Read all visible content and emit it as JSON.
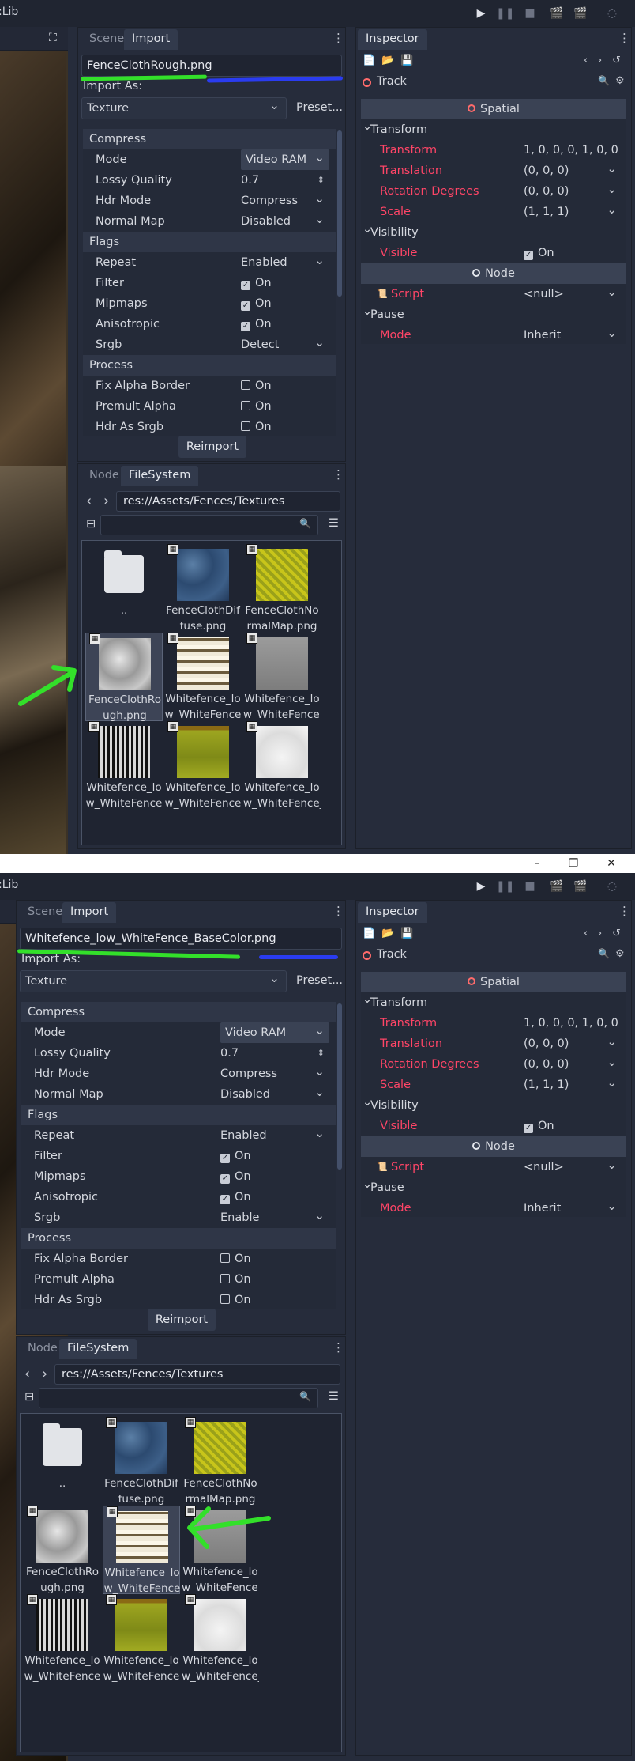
{
  "app": {
    "title": ":Lib"
  },
  "window": {
    "minimize": "–",
    "restore": "❐",
    "close": "✕"
  },
  "colors": {
    "accent": "#ff4567",
    "background": "#262c3b",
    "annotation_green": "#33e02a",
    "annotation_blue": "#2a3cf0"
  },
  "import_panel": {
    "tab_scene": "Scene",
    "tab_import": "Import",
    "import_as_label": "Import As:",
    "import_as_value": "Texture",
    "preset_label": "Preset...",
    "reimport_label": "Reimport"
  },
  "shots": [
    {
      "filename": "FenceClothRough.png",
      "props": [
        {
          "k": "Compress",
          "sec": true
        },
        {
          "k": "Mode",
          "v": "Video RAM",
          "dd": true,
          "btn": true
        },
        {
          "k": "Lossy Quality",
          "v": "0.7",
          "spin": true
        },
        {
          "k": "Hdr Mode",
          "v": "Compress",
          "dd": true
        },
        {
          "k": "Normal Map",
          "v": "Disabled",
          "dd": true
        },
        {
          "k": "Flags",
          "sec": true
        },
        {
          "k": "Repeat",
          "v": "Enabled",
          "dd": true
        },
        {
          "k": "Filter",
          "v": "On",
          "cb": true
        },
        {
          "k": "Mipmaps",
          "v": "On",
          "cb": true
        },
        {
          "k": "Anisotropic",
          "v": "On",
          "cb": true
        },
        {
          "k": "Srgb",
          "v": "Detect",
          "dd": true
        },
        {
          "k": "Process",
          "sec": true
        },
        {
          "k": "Fix Alpha Border",
          "v": "On",
          "cb": false
        },
        {
          "k": "Premult Alpha",
          "v": "On",
          "cb": false
        },
        {
          "k": "Hdr As Srgb",
          "v": "On",
          "cb": false
        }
      ],
      "selected_index": 3
    },
    {
      "filename": "Whitefence_low_WhiteFence_BaseColor.png",
      "props": [
        {
          "k": "Compress",
          "sec": true
        },
        {
          "k": "Mode",
          "v": "Video RAM",
          "dd": true,
          "btn": true
        },
        {
          "k": "Lossy Quality",
          "v": "0.7",
          "spin": true
        },
        {
          "k": "Hdr Mode",
          "v": "Compress",
          "dd": true
        },
        {
          "k": "Normal Map",
          "v": "Disabled",
          "dd": true
        },
        {
          "k": "Flags",
          "sec": true
        },
        {
          "k": "Repeat",
          "v": "Enabled",
          "dd": true
        },
        {
          "k": "Filter",
          "v": "On",
          "cb": true
        },
        {
          "k": "Mipmaps",
          "v": "On",
          "cb": true
        },
        {
          "k": "Anisotropic",
          "v": "On",
          "cb": true
        },
        {
          "k": "Srgb",
          "v": "Enable",
          "dd": true
        },
        {
          "k": "Process",
          "sec": true
        },
        {
          "k": "Fix Alpha Border",
          "v": "On",
          "cb": false
        },
        {
          "k": "Premult Alpha",
          "v": "On",
          "cb": false
        },
        {
          "k": "Hdr As Srgb",
          "v": "On",
          "cb": false
        }
      ],
      "selected_index": 4
    }
  ],
  "filesystem": {
    "tab_node": "Node",
    "tab_filesystem": "FileSystem",
    "path": "res://Assets/Fences/Textures",
    "back_icon": "‹",
    "forward_icon": "›",
    "items": [
      {
        "cap1": "..",
        "cap2": "",
        "thumb": "folder"
      },
      {
        "cap1": "FenceClothDif",
        "cap2": "fuse.png",
        "thumb": "t-blue"
      },
      {
        "cap1": "FenceClothNo",
        "cap2": "rmalMap.png",
        "thumb": "t-yellow"
      },
      {
        "cap1": "FenceClothRo",
        "cap2": "ugh.png",
        "thumb": "t-rough"
      },
      {
        "cap1": "Whitefence_lo",
        "cap2": "w_WhiteFence",
        "thumb": "t-base"
      },
      {
        "cap1": "Whitefence_lo",
        "cap2": "w_WhiteFence_",
        "thumb": "t-gray"
      },
      {
        "cap1": "Whitefence_lo",
        "cap2": "w_WhiteFence",
        "thumb": "t-bw"
      },
      {
        "cap1": "Whitefence_lo",
        "cap2": "w_WhiteFence",
        "thumb": "t-olive"
      },
      {
        "cap1": "Whitefence_lo",
        "cap2": "w_WhiteFence_",
        "thumb": "t-white"
      }
    ]
  },
  "inspector": {
    "tab": "Inspector",
    "node_label": "Track",
    "rows": [
      {
        "k": "Spatial",
        "type": "head"
      },
      {
        "k": "Transform",
        "type": "group"
      },
      {
        "k": "Transform",
        "v": "1, 0, 0, 0, 1, 0, 0",
        "red": true
      },
      {
        "k": "Translation",
        "v": "(0, 0, 0)",
        "red": true,
        "dd": true
      },
      {
        "k": "Rotation Degrees",
        "v": "(0, 0, 0)",
        "red": true,
        "dd": true
      },
      {
        "k": "Scale",
        "v": "(1, 1, 1)",
        "red": true,
        "dd": true
      },
      {
        "k": "Visibility",
        "type": "group"
      },
      {
        "k": "Visible",
        "v": "On",
        "red": true,
        "cb": true
      },
      {
        "k": "Node",
        "type": "head"
      },
      {
        "k": "Script",
        "v": "<null>",
        "red": true,
        "dd": true,
        "script": true
      },
      {
        "k": "Pause",
        "type": "group"
      },
      {
        "k": "Mode",
        "v": "Inherit",
        "red": true,
        "dd": true
      }
    ]
  }
}
